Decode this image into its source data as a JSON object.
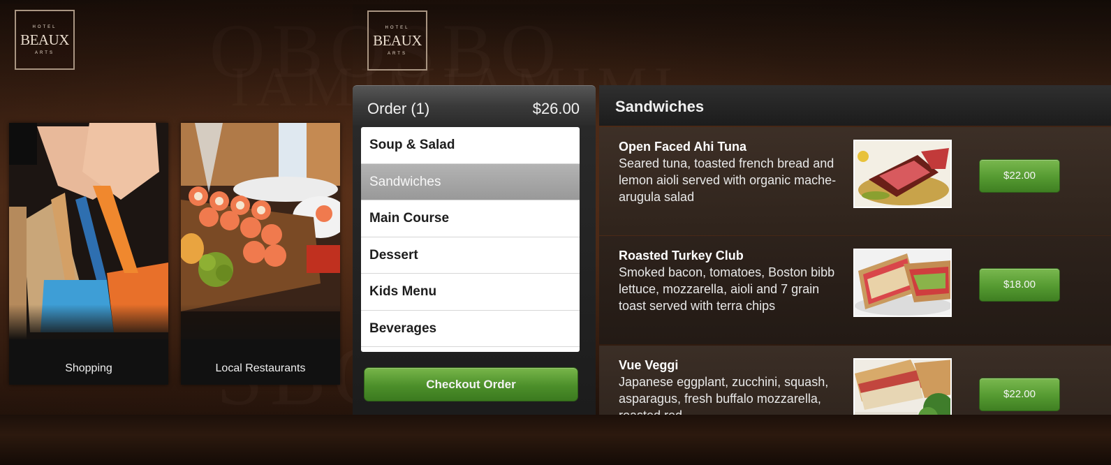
{
  "brand": {
    "top_small": "HOTEL",
    "name": "BEAUX",
    "bottom_small": "ARTS"
  },
  "tiles": [
    {
      "label": "Shopping",
      "image": "shopping-bags-photo"
    },
    {
      "label": "Local Restaurants",
      "image": "sushi-platter-photo"
    }
  ],
  "order": {
    "title": "Order (1)",
    "total": "$26.00",
    "checkout_label": "Checkout Order"
  },
  "categories": [
    {
      "label": "Soup & Salad",
      "selected": false
    },
    {
      "label": "Sandwiches",
      "selected": true
    },
    {
      "label": "Main Course",
      "selected": false
    },
    {
      "label": "Dessert",
      "selected": false
    },
    {
      "label": "Kids Menu",
      "selected": false
    },
    {
      "label": "Beverages",
      "selected": false
    }
  ],
  "menu": {
    "section_title": "Sandwiches",
    "items": [
      {
        "name": "Open Faced Ahi Tuna",
        "description": "Seared tuna, toasted french bread and lemon aioli served with organic mache- arugula salad",
        "price": "$22.00",
        "image": "ahi-tuna-photo"
      },
      {
        "name": "Roasted Turkey Club",
        "description": "Smoked bacon, tomatoes, Boston bibb lettuce, mozzarella, aioli and 7 grain toast served with terra chips",
        "price": "$18.00",
        "image": "turkey-club-photo"
      },
      {
        "name": "Vue Veggi",
        "description": "Japanese eggplant, zucchini, squash, asparagus, fresh buffalo mozzarella, roasted red",
        "price": "$22.00",
        "image": "veggie-sandwich-photo"
      }
    ]
  },
  "colors": {
    "accent_green": "#559a31",
    "selected_gray": "#a6a6a6",
    "background_brown": "#4a2b18"
  }
}
